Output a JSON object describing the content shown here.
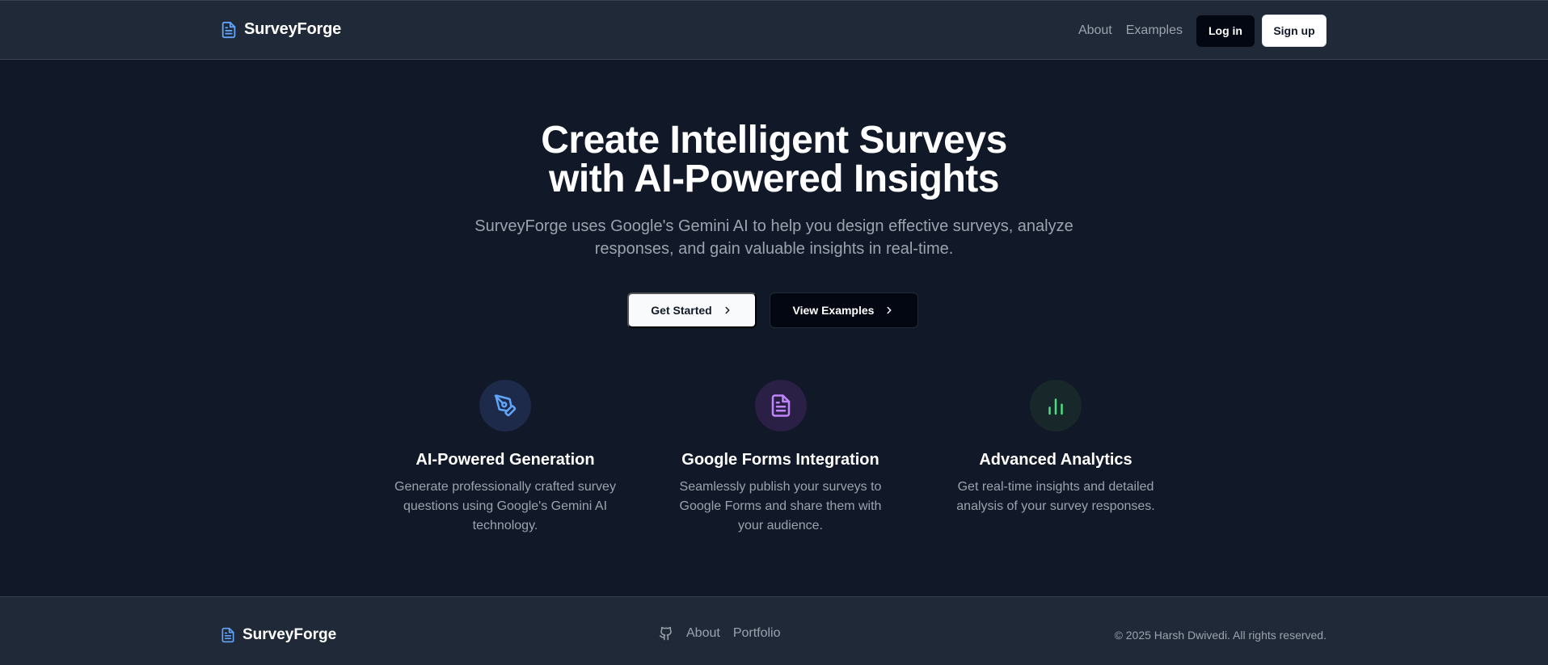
{
  "header": {
    "brand": "SurveyForge",
    "nav": [
      {
        "label": "About"
      },
      {
        "label": "Examples"
      }
    ],
    "login_label": "Log in",
    "signup_label": "Sign up"
  },
  "hero": {
    "title_line1": "Create Intelligent Surveys",
    "title_line2": "with AI-Powered Insights",
    "subtitle": "SurveyForge uses Google's Gemini AI to help you design effective surveys, analyze responses, and gain valuable insights in real-time.",
    "primary_cta": "Get Started",
    "secondary_cta": "View Examples"
  },
  "features": [
    {
      "icon": "pen-tool-icon",
      "title": "AI-Powered Generation",
      "description": "Generate professionally crafted survey questions using Google's Gemini AI technology.",
      "accent": "#60a5fa"
    },
    {
      "icon": "file-text-icon",
      "title": "Google Forms Integration",
      "description": "Seamlessly publish your surveys to Google Forms and share them with your audience.",
      "accent": "#c084fc"
    },
    {
      "icon": "bar-chart-icon",
      "title": "Advanced Analytics",
      "description": "Get real-time insights and detailed analysis of your survey responses.",
      "accent": "#4ade80"
    }
  ],
  "footer": {
    "brand": "SurveyForge",
    "links": [
      {
        "label": "About"
      },
      {
        "label": "Portfolio"
      }
    ],
    "copyright": "© 2025 Harsh Dwivedi. All rights reserved."
  },
  "colors": {
    "background": "#111827",
    "header_bg": "#1f2937",
    "brand_icon": "#60a5fa",
    "muted_text": "#9ca3af"
  }
}
